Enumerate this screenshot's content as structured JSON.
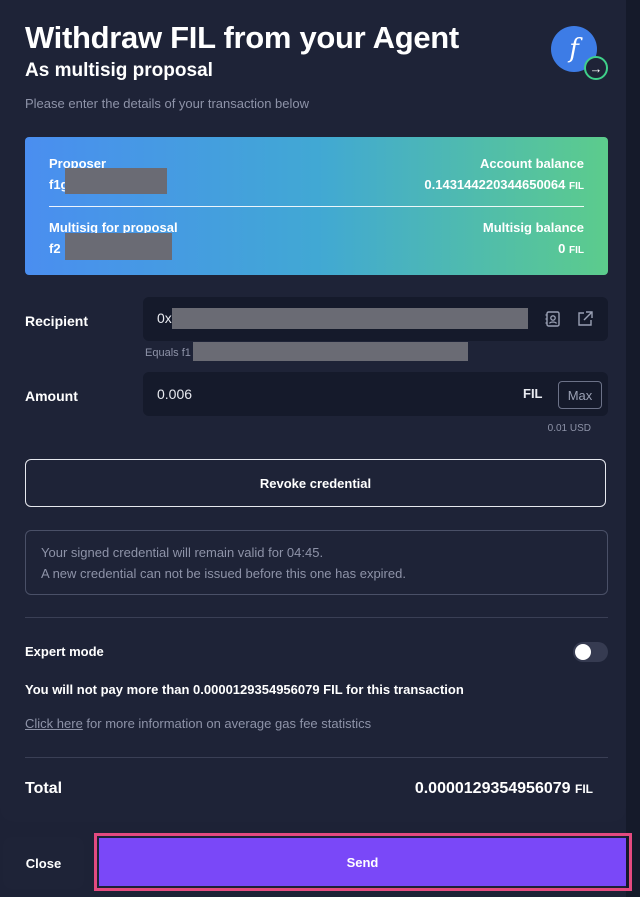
{
  "header": {
    "title": "Withdraw FIL from your Agent",
    "subtitle": "As multisig proposal",
    "instructions": "Please enter the details of your transaction below",
    "logo_glyph": "f",
    "logo_badge_glyph": "→"
  },
  "summary_card": {
    "proposer_label": "Proposer",
    "proposer_value": "f1g",
    "account_balance_label": "Account balance",
    "account_balance_value": "0.143144220344650064",
    "account_balance_unit": "FIL",
    "multisig_label": "Multisig for proposal",
    "multisig_value": "f2",
    "multisig_balance_label": "Multisig balance",
    "multisig_balance_value": "0",
    "multisig_balance_unit": "FIL"
  },
  "recipient": {
    "label": "Recipient",
    "value": "0x",
    "equals_text": "Equals f1"
  },
  "amount": {
    "label": "Amount",
    "value": "0.006",
    "unit": "FIL",
    "max_label": "Max",
    "usd_value": "0.01 USD"
  },
  "revoke_button_label": "Revoke credential",
  "credential_info": {
    "line1": "Your signed credential will remain valid for 04:45.",
    "line2": "A new credential can not be issued before this one has expired."
  },
  "expert_mode": {
    "label": "Expert mode",
    "enabled": false
  },
  "fee_notice": "You will not pay more than 0.0000129354956079 FIL for this transaction",
  "gas_info": {
    "link_text": "Click here",
    "rest_text": " for more information on average gas fee statistics"
  },
  "total": {
    "label": "Total",
    "value": "0.0000129354956079",
    "unit": "FIL"
  },
  "footer": {
    "close_label": "Close",
    "send_label": "Send"
  },
  "colors": {
    "background": "#1e2337",
    "send_button": "#7a48f8",
    "send_highlight": "#e44a80",
    "gradient_start": "#4a8ef0",
    "gradient_end": "#5ccc8c"
  }
}
